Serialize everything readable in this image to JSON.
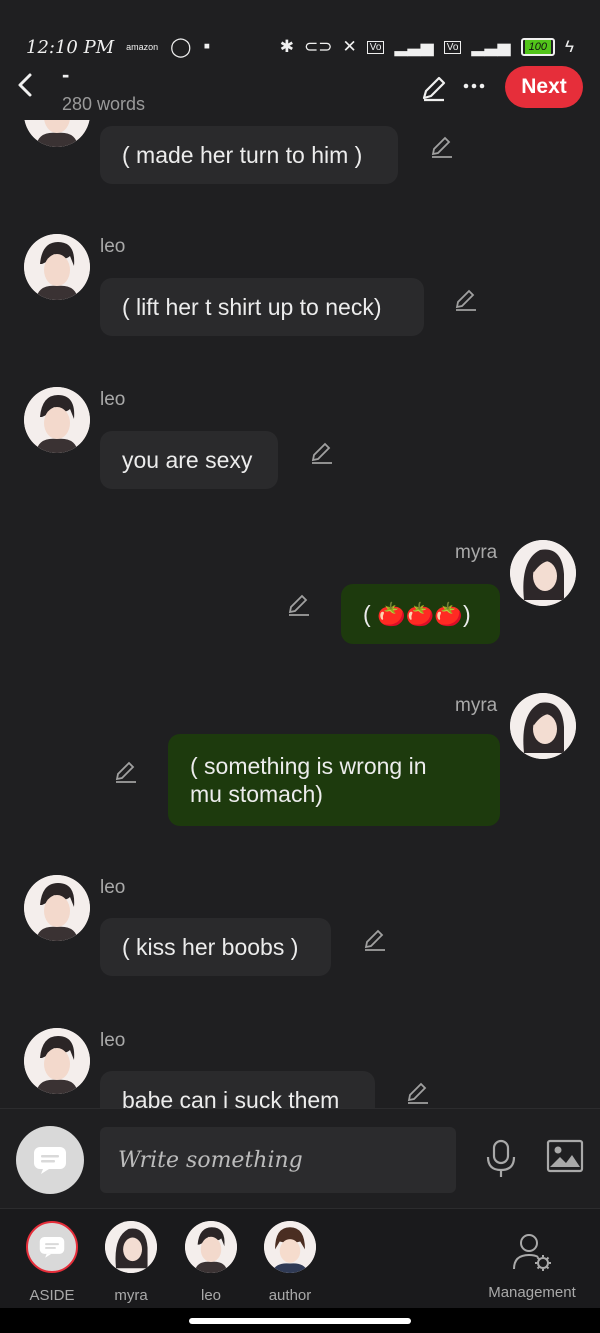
{
  "status_bar": {
    "time": "12:10 PM",
    "notification_icons": [
      "amazon-icon",
      "whatsapp-icon",
      "messages-icon"
    ],
    "system_icons": [
      "bluetooth-icon",
      "toggle-icon",
      "mute-icon",
      "volte-icon",
      "4g-signal-icon",
      "volte-icon",
      "signal-icon"
    ],
    "battery_level": "100"
  },
  "header": {
    "title": "-",
    "word_count": "280 words",
    "next_label": "Next",
    "accent_color": "#e62e3a"
  },
  "messages": [
    {
      "speaker": "",
      "text": "( made her turn to him )",
      "side": "left",
      "character": "leo"
    },
    {
      "speaker": "leo",
      "text": "( lift her t shirt up to neck)",
      "side": "left",
      "character": "leo"
    },
    {
      "speaker": "leo",
      "text": "you are sexy",
      "side": "left",
      "character": "leo"
    },
    {
      "speaker": "myra",
      "text": "( 🍅🍅🍅)",
      "side": "right",
      "character": "myra"
    },
    {
      "speaker": "myra",
      "text": "( something is wrong in mu stomach)",
      "side": "right",
      "character": "myra"
    },
    {
      "speaker": "leo",
      "text": "( kiss her boobs )",
      "side": "left",
      "character": "leo"
    },
    {
      "speaker": "leo",
      "text": "babe can i suck them",
      "side": "left",
      "character": "leo"
    }
  ],
  "composer": {
    "placeholder": "Write something"
  },
  "characters": [
    {
      "label": "ASIDE"
    },
    {
      "label": "myra"
    },
    {
      "label": "leo"
    },
    {
      "label": "author"
    }
  ],
  "management_label": "Management",
  "colors": {
    "background": "#1f1f21",
    "bubble_other": "#2a2a2c",
    "bubble_mine": "#1d3a0d"
  }
}
